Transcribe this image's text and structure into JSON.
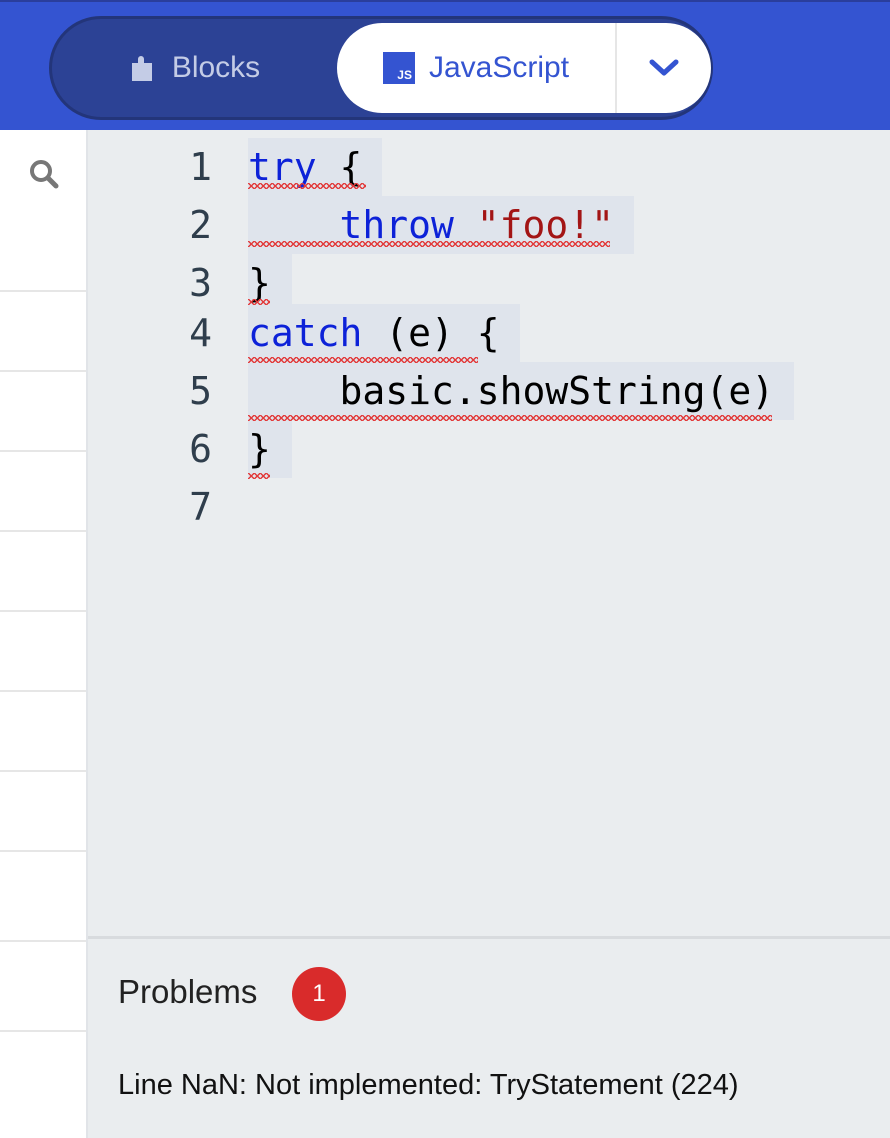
{
  "header": {
    "blocks_label": "Blocks",
    "javascript_label": "JavaScript",
    "js_icon_text": "JS",
    "accent_color": "#3454d1"
  },
  "editor": {
    "lines": [
      {
        "num": "1",
        "tokens": [
          {
            "t": "try",
            "c": "kw"
          },
          {
            "t": " {",
            "c": ""
          }
        ]
      },
      {
        "num": "2",
        "tokens": [
          {
            "t": "    throw",
            "c": "kw"
          },
          {
            "t": " ",
            "c": ""
          },
          {
            "t": "\"foo!\"",
            "c": "str"
          }
        ]
      },
      {
        "num": "3",
        "tokens": [
          {
            "t": "}",
            "c": ""
          }
        ]
      },
      {
        "num": "4",
        "tokens": [
          {
            "t": "catch",
            "c": "kw"
          },
          {
            "t": " (e) {",
            "c": ""
          }
        ]
      },
      {
        "num": "5",
        "tokens": [
          {
            "t": "    basic.showString(e)",
            "c": ""
          }
        ]
      },
      {
        "num": "6",
        "tokens": [
          {
            "t": "}",
            "c": ""
          }
        ]
      },
      {
        "num": "7",
        "tokens": []
      }
    ]
  },
  "problems": {
    "title": "Problems",
    "count": "1",
    "message": "Line NaN: Not implemented: TryStatement (224)",
    "badge_color": "#d92b2b"
  }
}
